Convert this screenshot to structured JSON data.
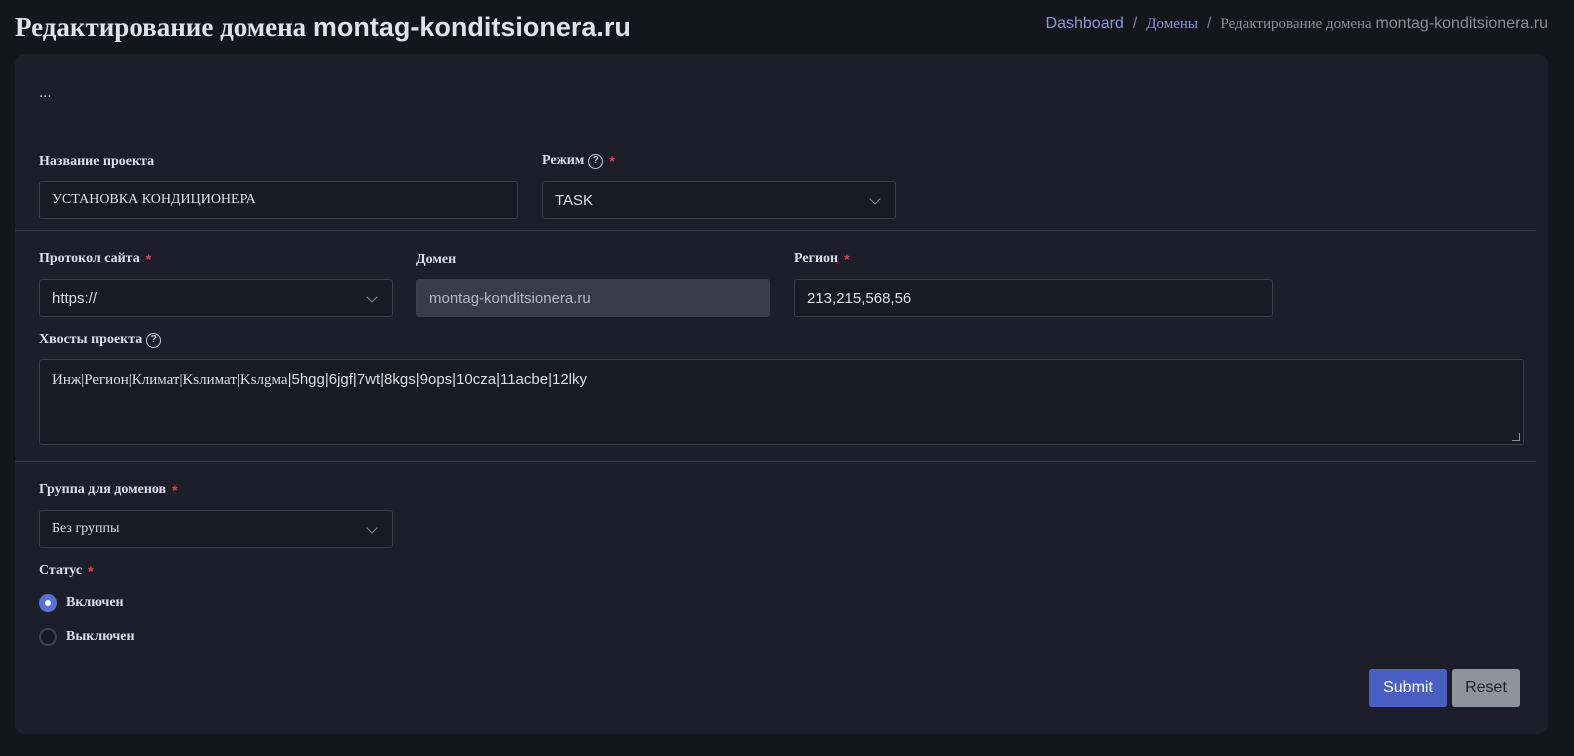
{
  "header": {
    "title_prefix": "Редактирование домена",
    "title_domain": "montag-konditsionera.ru"
  },
  "breadcrumb": {
    "dashboard": "Dashboard",
    "domains": "Домены",
    "current_prefix": "Редактирование домена",
    "current_domain": "montag-konditsionera.ru"
  },
  "form": {
    "ellipsis": "...",
    "project_name": {
      "label": "Название проекта",
      "value": "УСТАНОВКА КОНДИЦИОНЕРА"
    },
    "mode": {
      "label": "Режим",
      "required": "*",
      "help": "?",
      "value": "TASK"
    },
    "protocol": {
      "label": "Протокол сайта",
      "required": "*",
      "value": "https://"
    },
    "domain": {
      "label": "Домен",
      "value": "montag-konditsionera.ru"
    },
    "region": {
      "label": "Регион",
      "required": "*",
      "value": "213,215,568,56"
    },
    "tails": {
      "label": "Хвосты проекта",
      "help": "?",
      "value_serif": "Инж|Регион|Климат|Ksлимат|Ksлgма",
      "value_sans": "|5hgg|6jgf|7wt|8kgs|9ops|10cza|11acbe|12lky"
    },
    "group": {
      "label": "Группа для доменов",
      "required": "*",
      "value": "Без группы"
    },
    "status": {
      "label": "Статус",
      "required": "*",
      "options": [
        {
          "label": "Включен",
          "checked": true
        },
        {
          "label": "Выключен",
          "checked": false
        }
      ]
    },
    "submit_label": "Submit",
    "reset_label": "Reset"
  },
  "colors": {
    "background": "#15151d",
    "card": "#1e1e2a",
    "accent": "#4a5fc4",
    "required": "#e0434d",
    "link": "#8b95d4"
  }
}
